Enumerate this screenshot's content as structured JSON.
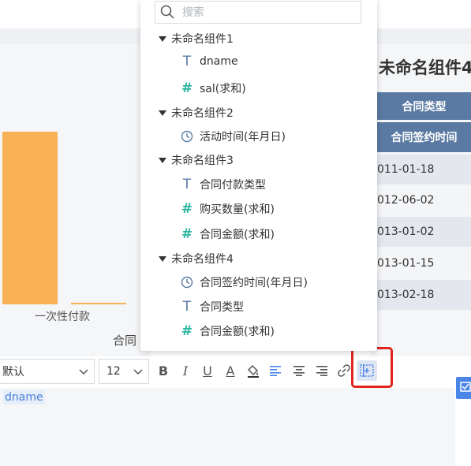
{
  "dropdown": {
    "search_placeholder": "搜索",
    "groups": [
      {
        "label": "未命名组件1",
        "fields": [
          {
            "icon": "text-T-icon",
            "label": "dname"
          },
          {
            "icon": "number-hash-icon",
            "label": "sal(求和)"
          }
        ]
      },
      {
        "label": "未命名组件2",
        "fields": [
          {
            "icon": "clock-icon",
            "label": "活动时间(年月日)"
          }
        ]
      },
      {
        "label": "未命名组件3",
        "fields": [
          {
            "icon": "text-T-icon",
            "label": "合同付款类型"
          },
          {
            "icon": "number-hash-icon",
            "label": "购买数量(求和)"
          },
          {
            "icon": "number-hash-icon",
            "label": "合同金额(求和)"
          }
        ]
      },
      {
        "label": "未命名组件4",
        "fields": [
          {
            "icon": "clock-icon",
            "label": "合同签约时间(年月日)"
          },
          {
            "icon": "text-T-icon",
            "label": "合同类型"
          },
          {
            "icon": "number-hash-icon",
            "label": "合同金额(求和)"
          }
        ]
      }
    ]
  },
  "chart": {
    "x_label": "一次性付款",
    "x_title": "合同",
    "bar_color": "#f8b155"
  },
  "table": {
    "title": "未命名组件4",
    "header1": "合同类型",
    "header2": "合同签约时间",
    "rows": [
      "011-01-18",
      "012-06-02",
      "013-01-02",
      "013-01-15",
      "013-02-18"
    ],
    "header_color": "#5b7aa3"
  },
  "toolbar": {
    "font_value": "默认",
    "size_value": "12",
    "bold": "B",
    "italic": "I",
    "underline": "U",
    "font_color": "A"
  },
  "editor": {
    "tag_text": "dname"
  }
}
